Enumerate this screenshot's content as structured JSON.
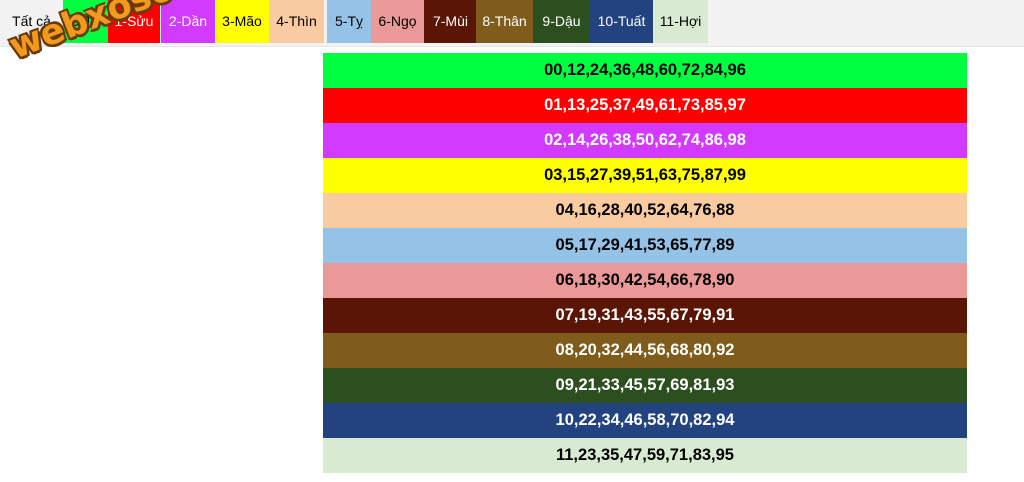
{
  "tabs": [
    {
      "label": "Tất cả",
      "bg": "#f2f2f2",
      "fg": "#000000"
    },
    {
      "label": "0-Tý",
      "bg": "#00ff40",
      "fg": "#000000"
    },
    {
      "label": "1-Sửu",
      "bg": "#ff0000",
      "fg": "#ffffff"
    },
    {
      "label": "2-Dần",
      "bg": "#d23bff",
      "fg": "#ffffff"
    },
    {
      "label": "3-Mão",
      "bg": "#ffff00",
      "fg": "#000000"
    },
    {
      "label": "4-Thìn",
      "bg": "#f8cba0",
      "fg": "#000000"
    },
    {
      "label": "5-Tỵ",
      "bg": "#95c3e8",
      "fg": "#000000"
    },
    {
      "label": "6-Ngọ",
      "bg": "#ea9898",
      "fg": "#000000"
    },
    {
      "label": "7-Mùi",
      "bg": "#5a1505",
      "fg": "#ffffff"
    },
    {
      "label": "8-Thân",
      "bg": "#7f5c1b",
      "fg": "#ffffff"
    },
    {
      "label": "9-Dậu",
      "bg": "#2c4f20",
      "fg": "#ffffff"
    },
    {
      "label": "10-Tuất",
      "bg": "#224380",
      "fg": "#ffffff"
    },
    {
      "label": "11-Hợi",
      "bg": "#d9ead3",
      "fg": "#000000"
    }
  ],
  "rows": [
    {
      "numbers": "00,12,24,36,48,60,72,84,96",
      "bg": "#00ff40",
      "fg": "#000000"
    },
    {
      "numbers": "01,13,25,37,49,61,73,85,97",
      "bg": "#ff0000",
      "fg": "#ffffff"
    },
    {
      "numbers": "02,14,26,38,50,62,74,86,98",
      "bg": "#d23bff",
      "fg": "#ffffff"
    },
    {
      "numbers": "03,15,27,39,51,63,75,87,99",
      "bg": "#ffff00",
      "fg": "#000000"
    },
    {
      "numbers": "04,16,28,40,52,64,76,88",
      "bg": "#f8cba0",
      "fg": "#000000"
    },
    {
      "numbers": "05,17,29,41,53,65,77,89",
      "bg": "#95c3e8",
      "fg": "#000000"
    },
    {
      "numbers": "06,18,30,42,54,66,78,90",
      "bg": "#ea9898",
      "fg": "#000000"
    },
    {
      "numbers": "07,19,31,43,55,67,79,91",
      "bg": "#5a1505",
      "fg": "#ffffff"
    },
    {
      "numbers": "08,20,32,44,56,68,80,92",
      "bg": "#7f5c1b",
      "fg": "#ffffff"
    },
    {
      "numbers": "09,21,33,45,57,69,81,93",
      "bg": "#2c4f20",
      "fg": "#ffffff"
    },
    {
      "numbers": "10,22,34,46,58,70,82,94",
      "bg": "#224380",
      "fg": "#ffffff"
    },
    {
      "numbers": "11,23,35,47,59,71,83,95",
      "bg": "#d9ead3",
      "fg": "#000000"
    }
  ],
  "watermark": "webxoso.net"
}
